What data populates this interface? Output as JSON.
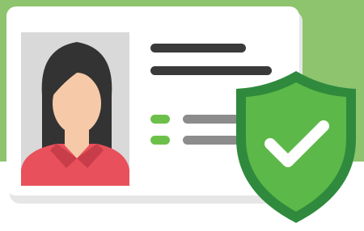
{
  "illustration": {
    "subject": "id-card-with-verified-shield",
    "icons": [
      "id-card-icon",
      "person-avatar-icon",
      "shield-check-icon"
    ],
    "colors": {
      "background_green": "#8dc46d",
      "card_white": "#ffffff",
      "card_shadow": "#e6e6e6",
      "photo_bg": "#d9d9d9",
      "hair": "#333333",
      "skin": "#f6caa9",
      "shirt": "#e8505b",
      "text_line_dark": "#3a3a3a",
      "text_line_gray": "#8c8c8c",
      "bullet_green": "#6cc04a",
      "shield_dark": "#2f8a3d",
      "shield_light": "#5cb848",
      "check_white": "#ffffff"
    }
  }
}
